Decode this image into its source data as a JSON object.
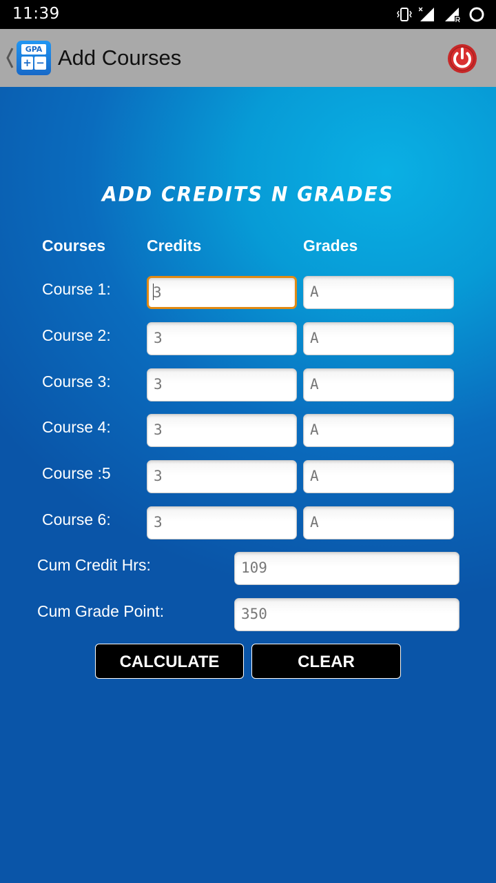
{
  "status_bar": {
    "time": "11:39"
  },
  "app_bar": {
    "title": "Add Courses",
    "app_icon": {
      "top": "GPA",
      "plus": "+",
      "minus": "−"
    }
  },
  "form": {
    "heading": "ADD CREDITS N GRADES",
    "columns": {
      "courses": "Courses",
      "credits": "Credits",
      "grades": "Grades"
    },
    "rows": [
      {
        "label": "Course 1:",
        "credit": "3",
        "grade": "A"
      },
      {
        "label": "Course 2:",
        "credit": "3",
        "grade": "A"
      },
      {
        "label": "Course 3:",
        "credit": "3",
        "grade": "A"
      },
      {
        "label": "Course 4:",
        "credit": "3",
        "grade": "A"
      },
      {
        "label": "Course :5",
        "credit": "3",
        "grade": "A"
      },
      {
        "label": "Course 6:",
        "credit": "3",
        "grade": "A"
      }
    ],
    "cum_credit_label": "Cum Credit Hrs:",
    "cum_credit_value": "109",
    "cum_grade_label": "Cum Grade Point:",
    "cum_grade_value": "350"
  },
  "buttons": {
    "calculate": "CALCULATE",
    "clear": "CLEAR"
  },
  "colors": {
    "appbar": "#a9a9a9",
    "focus_border": "#e08a14",
    "power_icon": "#c62828"
  }
}
